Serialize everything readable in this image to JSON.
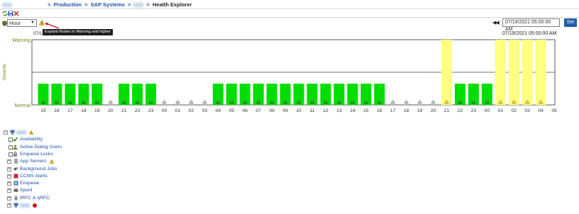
{
  "breadcrumb": {
    "items": [
      "Production",
      "SAP Systems",
      "Health Explorer"
    ],
    "separator": ">"
  },
  "controls": {
    "granularity_value": "Hour",
    "tooltip": "Expand Nodes in Warning and higher",
    "datetime_value": "07/19/2021 05:00:00 AM",
    "set_label": "Set",
    "start_label": "07/1",
    "end_label": "07/19/2021 05:00:00 AM"
  },
  "colors": {
    "normal": "#00dd00",
    "warning": "#ffff80",
    "link": "#1c4fa8",
    "set_button": "#1f5fa8"
  },
  "chart_data": {
    "type": "bar",
    "ylabel": "Severity",
    "y_levels": [
      "Normal",
      "Warning"
    ],
    "categories": [
      "15",
      "16",
      "17",
      "18",
      "19",
      "20",
      "21",
      "22",
      "23",
      "00",
      "01",
      "02",
      "03",
      "04",
      "05",
      "06",
      "07",
      "08",
      "09",
      "10",
      "11",
      "12",
      "13",
      "14",
      "15",
      "16",
      "17",
      "18",
      "19",
      "20",
      "21",
      "22",
      "23",
      "00",
      "01",
      "02",
      "03",
      "04",
      "05"
    ],
    "status": [
      "normal",
      "normal",
      "normal",
      "normal",
      "normal",
      "none",
      "normal",
      "normal",
      "normal",
      "none",
      "none",
      "none",
      "none",
      "normal",
      "normal",
      "normal",
      "normal",
      "normal",
      "normal",
      "normal",
      "normal",
      "normal",
      "normal",
      "normal",
      "normal",
      "normal",
      "none",
      "none",
      "none",
      "none",
      "warning",
      "normal",
      "normal",
      "normal",
      "warning",
      "warning",
      "warning",
      "warning",
      "none"
    ],
    "level": [
      0.5,
      0.5,
      0.5,
      0.5,
      0.5,
      0,
      0.5,
      0.5,
      0.5,
      0,
      0,
      0,
      0,
      0.5,
      0.5,
      0.5,
      0.5,
      0.5,
      0.5,
      0.5,
      0.5,
      0.5,
      0.5,
      0.5,
      0.5,
      0.5,
      0,
      0,
      0,
      0,
      1,
      0.5,
      0.5,
      0.5,
      1,
      1,
      1,
      1,
      0
    ]
  },
  "tree": {
    "nodes": [
      {
        "label": "",
        "expander": "minus",
        "icon": "system-icon",
        "warn": true,
        "level": 0
      },
      {
        "label": "Availability",
        "check": true,
        "icon": "check-icon",
        "level": 1
      },
      {
        "label": "Active Dialog Users",
        "check": true,
        "icon": "users-icon",
        "level": 1
      },
      {
        "label": "Enqueue Locks",
        "check": true,
        "icon": "lock-icon",
        "level": 1
      },
      {
        "label": "App Servers",
        "expander": "plus",
        "icon": "server-icon",
        "warn": true,
        "level": 1
      },
      {
        "label": "Background Jobs",
        "expander": "plus",
        "icon": "jobs-icon",
        "level": 1
      },
      {
        "label": "CCMS Alerts",
        "expander": "plus",
        "icon": "alert-icon",
        "level": 1
      },
      {
        "label": "Enqueue",
        "expander": "plus",
        "icon": "enqueue-icon",
        "level": 1
      },
      {
        "label": "Spool",
        "expander": "plus",
        "icon": "printer-icon",
        "level": 1
      },
      {
        "label": "tRFC & qRFC",
        "expander": "plus",
        "icon": "rfc-icon",
        "level": 1
      },
      {
        "label": "",
        "expander": "plus",
        "icon": "system-icon",
        "error": true,
        "level": 1
      }
    ]
  }
}
